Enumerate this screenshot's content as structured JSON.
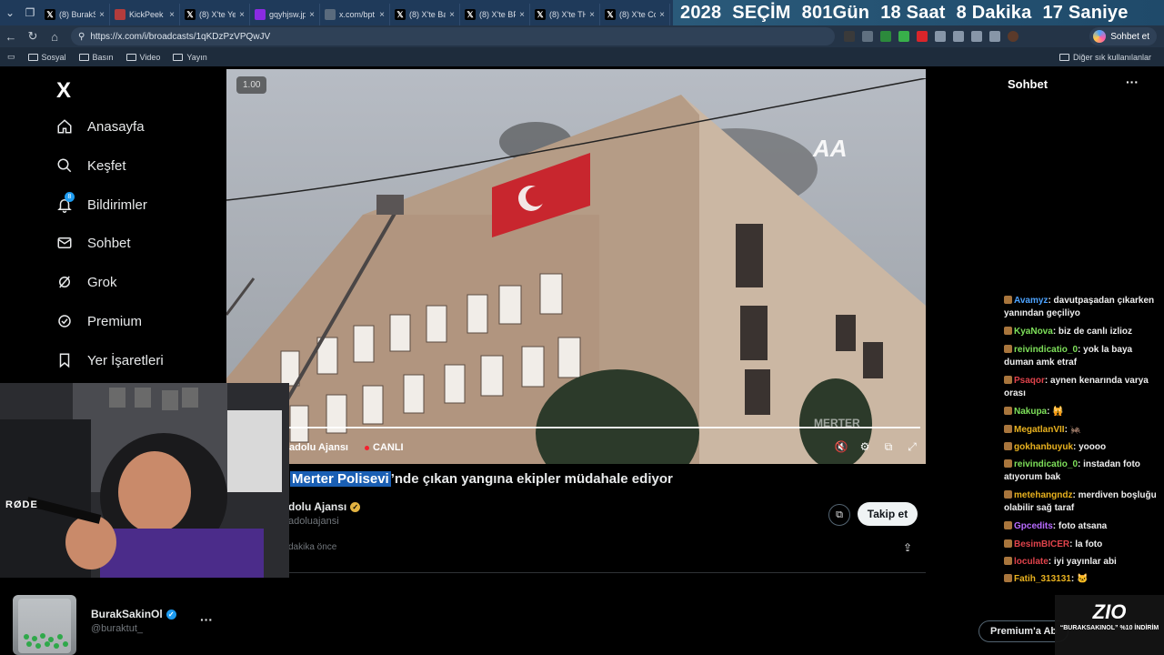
{
  "browser": {
    "tabs": [
      {
        "label": "(8) BurakSa",
        "icon": "x-icon",
        "color": "#000000"
      },
      {
        "label": "KickPeek -",
        "icon": "kickpeek-icon",
        "color": "#b33c3c"
      },
      {
        "label": "(8) X'te Yer",
        "icon": "x-icon",
        "color": "#000000"
      },
      {
        "label": "gqyhjsw.jp",
        "icon": "image-icon",
        "color": "#8a2be2"
      },
      {
        "label": "x.com/bpt",
        "icon": "page-icon",
        "color": "#5a6b7d"
      },
      {
        "label": "(8) X'te Bay",
        "icon": "x-icon",
        "color": "#000000"
      },
      {
        "label": "(8) X'te BPT",
        "icon": "x-icon",
        "color": "#000000"
      },
      {
        "label": "(8) X'te TH",
        "icon": "x-icon",
        "color": "#000000"
      },
      {
        "label": "(8) X'te Co",
        "icon": "x-icon",
        "color": "#000000"
      }
    ],
    "countdown": [
      "2028",
      "SEÇİM",
      "801Gün",
      "18 Saat",
      "8 Dakika",
      "17 Saniye"
    ],
    "url": "https://x.com/i/broadcasts/1qKDzPzVPQwJV",
    "copilot_label": "Sohbet et",
    "bookmarks": [
      "Sosyal",
      "Basın",
      "Video",
      "Yayın"
    ],
    "other_bookmarks": "Diğer sık kullanılanlar"
  },
  "sidebar": {
    "logo": "X",
    "items": [
      {
        "label": "Anasayfa",
        "icon": "home-icon"
      },
      {
        "label": "Keşfet",
        "icon": "search-icon"
      },
      {
        "label": "Bildirimler",
        "icon": "bell-icon",
        "badge": "8"
      },
      {
        "label": "Sohbet",
        "icon": "mail-icon"
      },
      {
        "label": "Grok",
        "icon": "grok-icon"
      },
      {
        "label": "Premium",
        "icon": "premium-icon"
      },
      {
        "label": "Yer İşaretleri",
        "icon": "bookmark-icon"
      }
    ]
  },
  "video": {
    "speed": "1.00",
    "source_partial": "adolu Ajansı",
    "live_label": "CANLI",
    "watermark": "MERTER"
  },
  "post": {
    "headline_highlight": "Merter Polisevi",
    "headline_rest": "’nde çıkan yangına ekipler müdahale ediyor",
    "author": "dolu Ajansı",
    "handle": "adoluajansi",
    "time": "dakika önce",
    "follow_label": "Takip et"
  },
  "profile": {
    "name": "BurakSakinOl",
    "handle": "@buraktut_"
  },
  "webcam": {
    "mic_brand": "RØDE"
  },
  "chat": {
    "title": "Sohbet",
    "messages": [
      {
        "user": "Avamyz",
        "color": "#4da3ff",
        "text": "davutpaşadan çıkarken yanından geçiliyo"
      },
      {
        "user": "KyaNova",
        "color": "#7ee05a",
        "text": "biz de canlı izlioz"
      },
      {
        "user": "reivindicatio_0",
        "color": "#7ee05a",
        "text": "yok la baya duman amk etraf"
      },
      {
        "user": "Psaqor",
        "color": "#e0434b",
        "text": "aynen kenarında varya orası"
      },
      {
        "user": "Nakupa",
        "color": "#7ee05a",
        "text": "🙀"
      },
      {
        "user": "MegatlanVII",
        "color": "#e9b21f",
        "text": "🦗"
      },
      {
        "user": "gokhanbuyuk",
        "color": "#e9b21f",
        "text": "yoooo"
      },
      {
        "user": "reivindicatio_0",
        "color": "#7ee05a",
        "text": "instadan foto atıyorum bak"
      },
      {
        "user": "metehangndz",
        "color": "#e9b21f",
        "text": "merdiven boşluğu olabilir sağ taraf"
      },
      {
        "user": "Gpcedits",
        "color": "#b86bff",
        "text": "foto atsana"
      },
      {
        "user": "BesimBICER",
        "color": "#e0434b",
        "text": "la foto"
      },
      {
        "user": "loculate",
        "color": "#e0434b",
        "text": "iyi yayınlar abi"
      },
      {
        "user": "Fatih_313131",
        "color": "#e9b21f",
        "text": "🐱"
      }
    ],
    "premium_btn": "Premium'a Ab",
    "promo_logo": "ZIO",
    "promo_code": "“BURAKSAKINOL” %10 İNDİRİM"
  }
}
